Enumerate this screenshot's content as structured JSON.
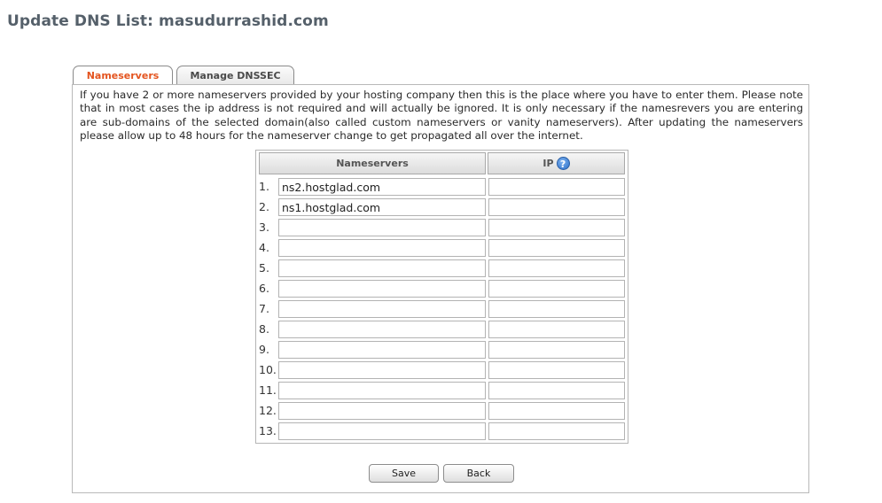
{
  "page": {
    "title": "Update DNS List: masudurrashid.com"
  },
  "tabs": [
    {
      "label": "Nameservers",
      "active": true
    },
    {
      "label": "Manage DNSSEC",
      "active": false
    }
  ],
  "intro": "If you have 2 or more nameservers provided by your hosting company then this is the place where you have to enter them. Please note that in most cases the ip address is not required and will actually be ignored. It is only necessary if the namesrevers you are entering are sub-domains of the selected domain(also called custom nameservers or vanity nameservers). After updating the nameservers please allow up to 48 hours for the nameserver change to get propagated all over the internet.",
  "table": {
    "col_nameservers": "Nameservers",
    "col_ip": "IP",
    "help_icon": "?",
    "rows": [
      {
        "num": "1.",
        "ns": "ns2.hostglad.com",
        "ip": ""
      },
      {
        "num": "2.",
        "ns": "ns1.hostglad.com",
        "ip": ""
      },
      {
        "num": "3.",
        "ns": "",
        "ip": ""
      },
      {
        "num": "4.",
        "ns": "",
        "ip": ""
      },
      {
        "num": "5.",
        "ns": "",
        "ip": ""
      },
      {
        "num": "6.",
        "ns": "",
        "ip": ""
      },
      {
        "num": "7.",
        "ns": "",
        "ip": ""
      },
      {
        "num": "8.",
        "ns": "",
        "ip": ""
      },
      {
        "num": "9.",
        "ns": "",
        "ip": ""
      },
      {
        "num": "10.",
        "ns": "",
        "ip": ""
      },
      {
        "num": "11.",
        "ns": "",
        "ip": ""
      },
      {
        "num": "12.",
        "ns": "",
        "ip": ""
      },
      {
        "num": "13.",
        "ns": "",
        "ip": ""
      }
    ]
  },
  "buttons": {
    "save": "Save",
    "back": "Back"
  },
  "colors": {
    "active_tab": "#e4541f",
    "title": "#55606a",
    "help_icon": "#2a6fc9"
  }
}
